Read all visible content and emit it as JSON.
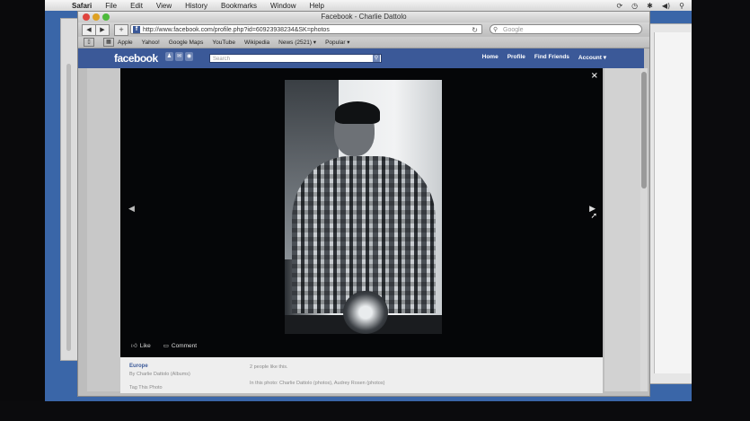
{
  "menubar": {
    "items": [
      "Safari",
      "File",
      "Edit",
      "View",
      "History",
      "Bookmarks",
      "Window",
      "Help"
    ]
  },
  "window": {
    "title": "Facebook - Charlie Dattolo"
  },
  "toolbar": {
    "url": "http://www.facebook.com/profile.php?id=60923938234&SK=photos",
    "search_placeholder": "Google"
  },
  "bookmarks": [
    "Apple",
    "Yahoo!",
    "Google Maps",
    "YouTube",
    "Wikipedia",
    "News (2521) ▾",
    "Popular ▾"
  ],
  "facebook": {
    "logo": "facebook",
    "search_placeholder": "Search",
    "nav": [
      "Home",
      "Profile",
      "Find Friends",
      "Account ▾"
    ]
  },
  "viewer": {
    "close": "×",
    "prev": "◀",
    "next": "▶",
    "like_label": "Like",
    "comment_label": "Comment"
  },
  "caption": {
    "album": "Europe",
    "by": "By Charlie Dattolo (Albums)",
    "tag": "Tag This Photo",
    "likes": "2 people like this.",
    "in_photo": "In this photo: Charlie Dattolo (photos), Audrey Rosen (photos)"
  },
  "colors": {
    "facebook_blue": "#3b5998",
    "desktop_blue": "#3a66a8"
  }
}
